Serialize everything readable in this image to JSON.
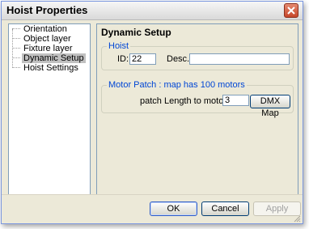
{
  "window": {
    "title": "Hoist Properties"
  },
  "tree": {
    "items": [
      {
        "label": "Orientation"
      },
      {
        "label": "Object layer"
      },
      {
        "label": "Fixture layer"
      },
      {
        "label": "Dynamic Setup"
      },
      {
        "label": "Hoist Settings"
      }
    ],
    "selected": "Dynamic Setup"
  },
  "panel": {
    "title": "Dynamic Setup",
    "hoist": {
      "legend": "Hoist",
      "id_label": "ID:",
      "id_value": "22",
      "desc_label": "Desc.:",
      "desc_value": ""
    },
    "motor": {
      "legend": "Motor Patch : map has 100 motors",
      "patch_label": "patch Length to motor #",
      "patch_value": "3",
      "dmx_button": "DMX Map"
    }
  },
  "footer": {
    "ok": "OK",
    "cancel": "Cancel",
    "apply": "Apply"
  },
  "colors": {
    "legend_text": "#0046d5",
    "selected_item_bg": "#c0c0c0"
  },
  "icons": {
    "close": "close-icon"
  }
}
